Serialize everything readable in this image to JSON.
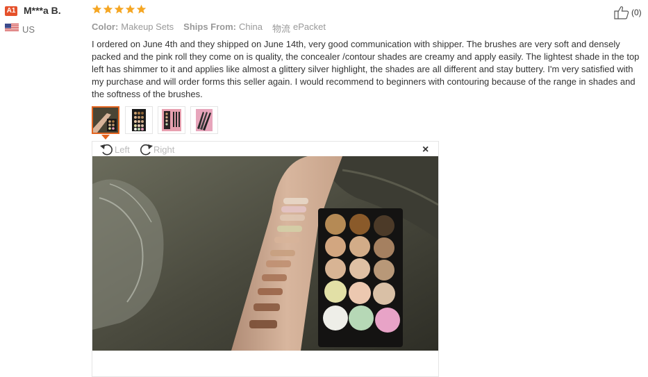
{
  "reviewer": {
    "level": "A1",
    "name": "M***a B.",
    "country": "US"
  },
  "rating": {
    "stars": 5,
    "max": 5,
    "color": "#f5a623"
  },
  "meta": {
    "color_label": "Color:",
    "color_value": "Makeup Sets",
    "ships_label": "Ships From:",
    "ships_value": "China",
    "logistics_label": "物流",
    "logistics_value": "ePacket"
  },
  "helpful": {
    "count": "(0)",
    "icon": "thumbs-up-icon"
  },
  "review_text": "I ordered on June 4th and they shipped on June 14th, very good communication with shipper. The brushes are very soft and densely packed and the pink roll they come on is quality, the concealer /contour shades are creamy and apply easily. The lightest shade in the top left has shimmer to it and applies like almost a glittery silver highlight, the shades are all different and stay buttery. I'm very satisfied with my purchase and will order forms this seller again. I would recommend to beginners with contouring because of the range in shades and the softness of the brushes.",
  "viewer": {
    "rotate_left": "Left",
    "rotate_right": "Right",
    "close": "×"
  },
  "colors": {
    "accent": "#e3641f",
    "badge": "#e5512b",
    "star": "#f5a623"
  }
}
